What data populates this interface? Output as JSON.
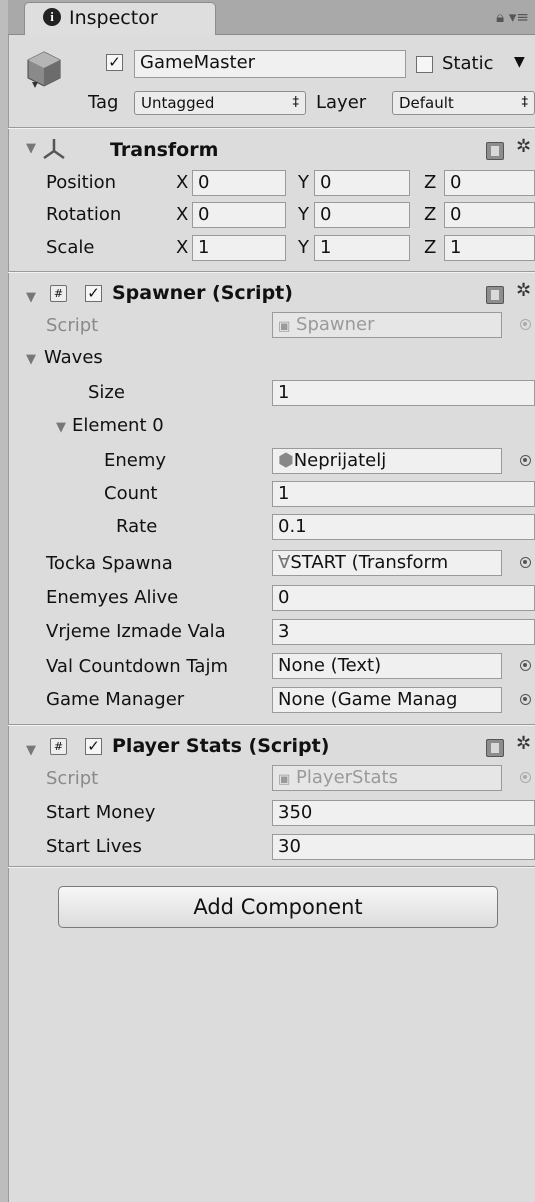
{
  "tab": {
    "title": "Inspector"
  },
  "object": {
    "name": "GameMaster",
    "static_label": "Static",
    "tag_label": "Tag",
    "tag_value": "Untagged",
    "layer_label": "Layer",
    "layer_value": "Default"
  },
  "transform": {
    "title": "Transform",
    "rows": [
      {
        "label": "Position",
        "x": "0",
        "y": "0",
        "z": "0"
      },
      {
        "label": "Rotation",
        "x": "0",
        "y": "0",
        "z": "0"
      },
      {
        "label": "Scale",
        "x": "1",
        "y": "1",
        "z": "1"
      }
    ],
    "axis": {
      "x": "X",
      "y": "Y",
      "z": "Z"
    }
  },
  "spawner": {
    "title": "Spawner (Script)",
    "script_label": "Script",
    "script_value": "Spawner",
    "waves_label": "Waves",
    "size_label": "Size",
    "size_value": "1",
    "element_label": "Element 0",
    "enemy_label": "Enemy",
    "enemy_value": "Neprijatelj",
    "count_label": "Count",
    "count_value": "1",
    "rate_label": "Rate",
    "rate_value": "0.1",
    "tocka_label": "Tocka Spawna",
    "tocka_value": "START (Transform",
    "alive_label": "Enemyes Alive",
    "alive_value": "0",
    "vrijeme_label": "Vrjeme Izmade Vala",
    "vrijeme_value": "3",
    "countdown_label": "Val Countdown Tajm",
    "countdown_value": "None (Text)",
    "gm_label": "Game Manager",
    "gm_value": "None (Game Manag"
  },
  "player": {
    "title": "Player Stats (Script)",
    "script_label": "Script",
    "script_value": "PlayerStats",
    "money_label": "Start Money",
    "money_value": "350",
    "lives_label": "Start Lives",
    "lives_value": "30"
  },
  "add_component": {
    "label": "Add Component"
  }
}
